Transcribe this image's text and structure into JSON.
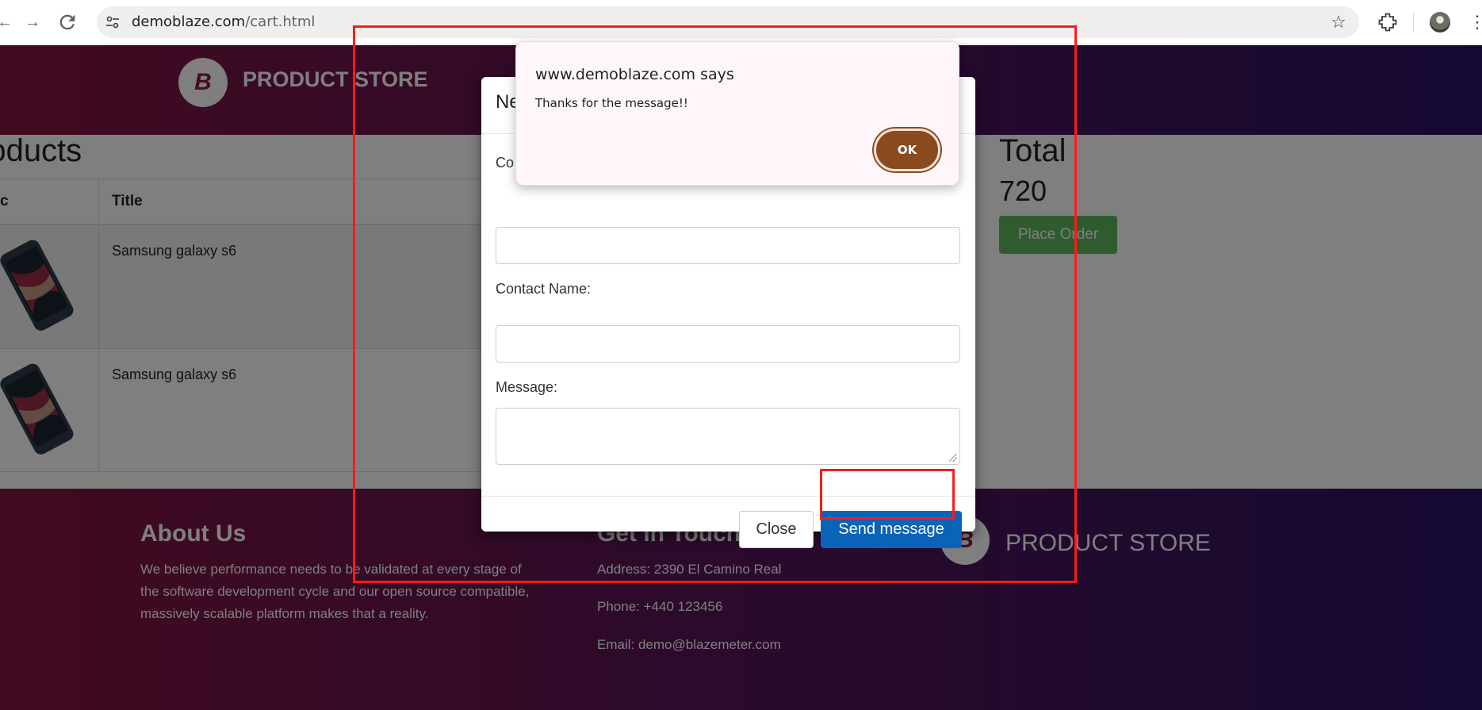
{
  "browser": {
    "url_domain": "demoblaze.com",
    "url_path": "/cart.html"
  },
  "nav": {
    "brand_logo_letter": "B",
    "brand": "PRODUCT STORE"
  },
  "cart": {
    "heading": "roducts",
    "columns": [
      "c",
      "Title"
    ],
    "rows": [
      {
        "title": "Samsung galaxy s6"
      },
      {
        "title": "Samsung galaxy s6"
      }
    ],
    "total_label": "Total",
    "total_value": "720",
    "place_order": "Place Order"
  },
  "modal": {
    "title": "Ne",
    "email_label": "Co",
    "name_label": "Contact Name:",
    "message_label": "Message:",
    "close_button": "Close",
    "send_button": "Send message"
  },
  "alert": {
    "title": "www.demoblaze.com says",
    "message": "Thanks for the message!!",
    "ok_button": "OK"
  },
  "footer": {
    "about_heading": "About Us",
    "about_text_1": "We believe performance needs to be validated at every stage of",
    "about_text_2": "the software development cycle and our open source compatible,",
    "about_text_3": "massively scalable platform makes that a reality.",
    "contact_heading": "Get in Touch",
    "address": "Address: 2390 El Camino Real",
    "phone": "Phone: +440 123456",
    "email": "Email: demo@blazemeter.com",
    "brand": "PRODUCT STORE",
    "brand_logo_letter": "B"
  },
  "annotation_color": "#ff1a1a"
}
